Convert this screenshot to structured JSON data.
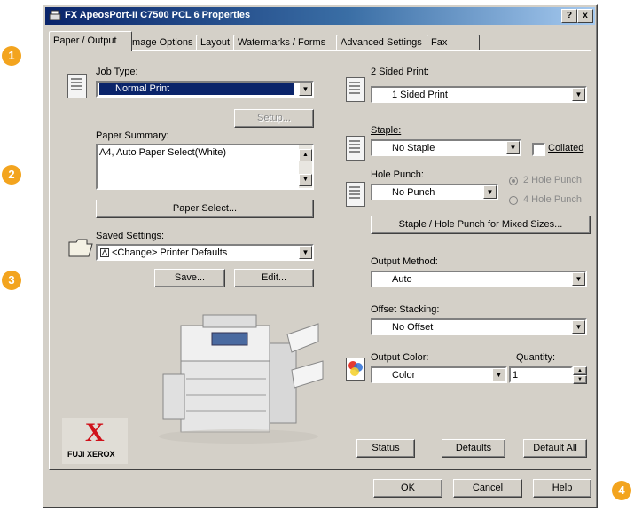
{
  "badges": [
    "1",
    "2",
    "3",
    "4"
  ],
  "window": {
    "title": "FX ApeosPort-II C7500 PCL 6 Properties",
    "help_btn": "?",
    "close_btn": "x"
  },
  "tabs": [
    "Paper / Output",
    "Image Options",
    "Layout",
    "Watermarks / Forms",
    "Advanced Settings",
    "Fax"
  ],
  "left": {
    "job_type_label": "Job Type:",
    "job_type_value": "Normal Print",
    "setup_button": "Setup...",
    "paper_summary_label": "Paper Summary:",
    "paper_summary_value": "A4, Auto Paper Select(White)",
    "paper_select_button": "Paper Select...",
    "saved_settings_label": "Saved Settings:",
    "saved_settings_value": "<Change> Printer Defaults",
    "save_button": "Save...",
    "edit_button": "Edit...",
    "brand_logo": "X",
    "brand_name": "FUJI XEROX"
  },
  "right": {
    "two_sided_label": "2 Sided Print:",
    "two_sided_value": "1 Sided Print",
    "staple_label": "Staple:",
    "staple_value": "No Staple",
    "collated_label": "Collated",
    "hole_punch_label": "Hole Punch:",
    "hole_punch_value": "No Punch",
    "two_hole_label": "2 Hole Punch",
    "four_hole_label": "4 Hole Punch",
    "mixed_sizes_button": "Staple / Hole Punch for Mixed Sizes...",
    "output_method_label": "Output Method:",
    "output_method_value": "Auto",
    "offset_label": "Offset Stacking:",
    "offset_value": "No Offset",
    "output_color_label": "Output Color:",
    "output_color_value": "Color",
    "quantity_label": "Quantity:",
    "quantity_value": "1",
    "status_button": "Status",
    "defaults_button": "Defaults",
    "default_all_button": "Default All"
  },
  "footer": {
    "ok": "OK",
    "cancel": "Cancel",
    "help": "Help"
  },
  "colors": {
    "badge": "#f3a41e",
    "titlebar": "#0a246a",
    "face": "#d4d0c8",
    "xerox_red": "#d0121b"
  }
}
